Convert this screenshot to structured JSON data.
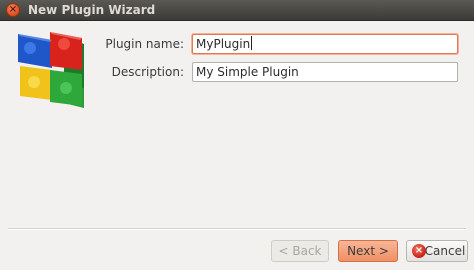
{
  "window": {
    "title": "New Plugin Wizard",
    "close_glyph": "×"
  },
  "logo": {
    "icon": "puzzle-pieces-icon"
  },
  "form": {
    "plugin_name_label": "Plugin name:",
    "plugin_name_value": "MyPlugin",
    "description_label": "Description:",
    "description_value": "My Simple Plugin"
  },
  "buttons": {
    "back_label": "< Back",
    "next_label": "Next >",
    "cancel_label": "Cancel",
    "cancel_glyph": "×"
  },
  "colors": {
    "titlebar": "#3c3b37",
    "accent": "#ef9066",
    "focus_border": "#e07a52",
    "window_bg": "#f2f1f0"
  }
}
